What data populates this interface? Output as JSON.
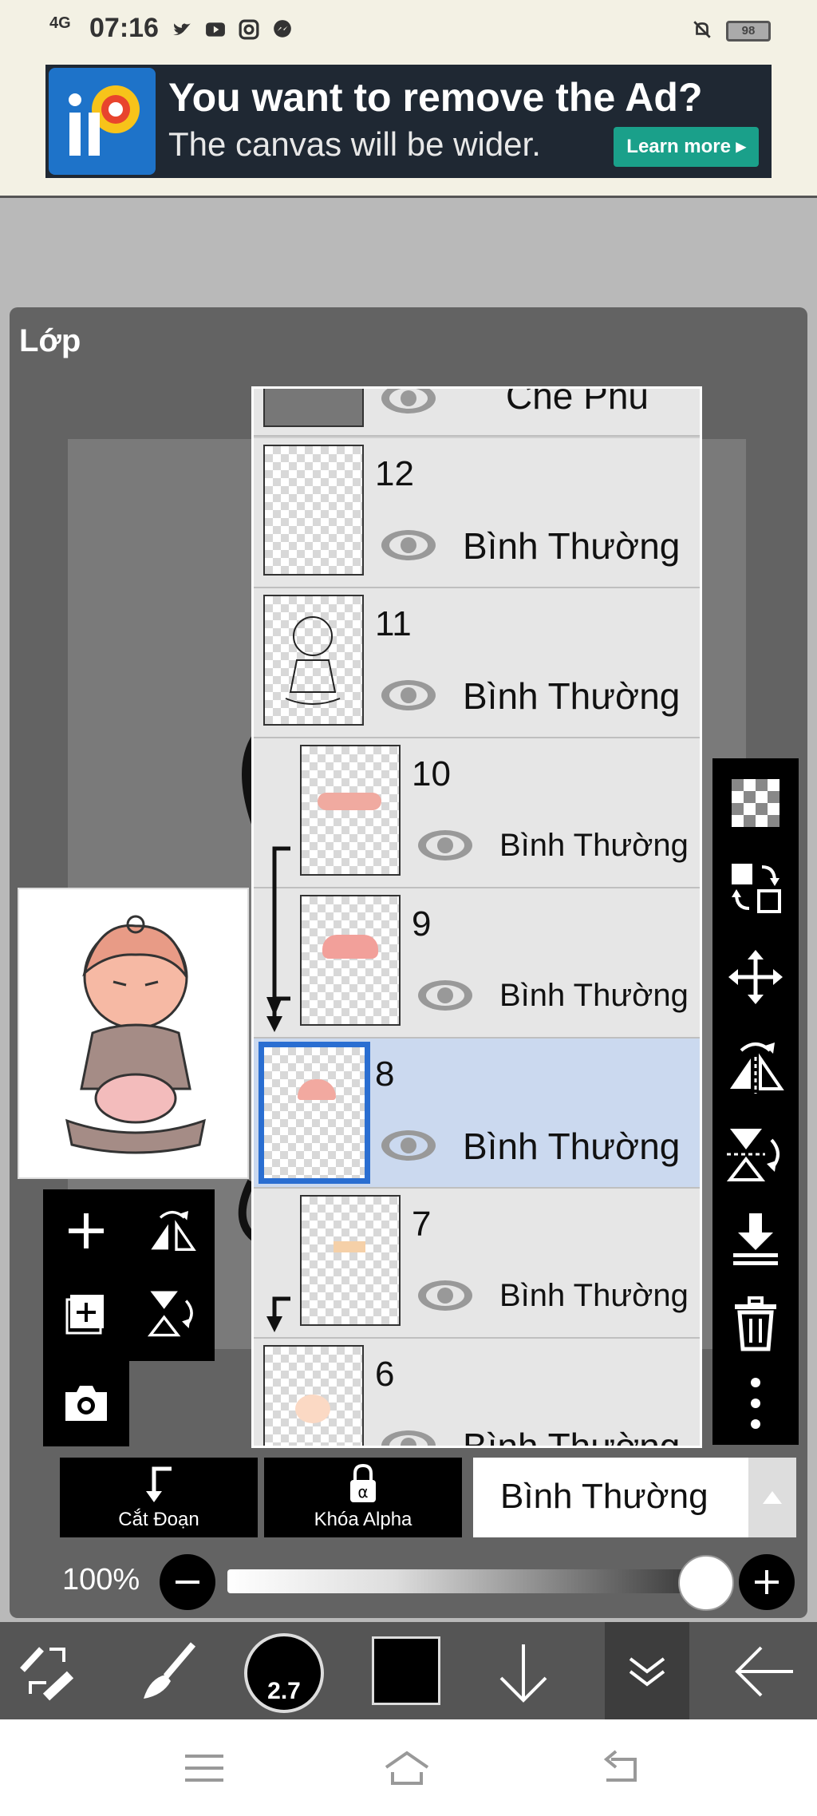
{
  "status_bar": {
    "network": "4G",
    "time": "07:16",
    "battery": "98"
  },
  "ad": {
    "title": "You want to remove the Ad?",
    "subtitle": "The canvas will be wider.",
    "button": "Learn more ▸"
  },
  "panel": {
    "title": "Lớp"
  },
  "layers": [
    {
      "number": "",
      "mode": "Che Phủ"
    },
    {
      "number": "12",
      "mode": "Bình Thường"
    },
    {
      "number": "11",
      "mode": "Bình Thường"
    },
    {
      "number": "10",
      "mode": "Bình Thường"
    },
    {
      "number": "9",
      "mode": "Bình Thường"
    },
    {
      "number": "8",
      "mode": "Bình Thường"
    },
    {
      "number": "7",
      "mode": "Bình Thường"
    },
    {
      "number": "6",
      "mode": "Bình Thường"
    }
  ],
  "blend": {
    "clip_label": "Cắt Đoạn",
    "alpha_label": "Khóa Alpha",
    "mode_value": "Bình Thường"
  },
  "opacity": {
    "label": "100%",
    "value": 1.0
  },
  "toolbar": {
    "brush_size": "2.7",
    "colors": {
      "current": "#000000"
    }
  }
}
